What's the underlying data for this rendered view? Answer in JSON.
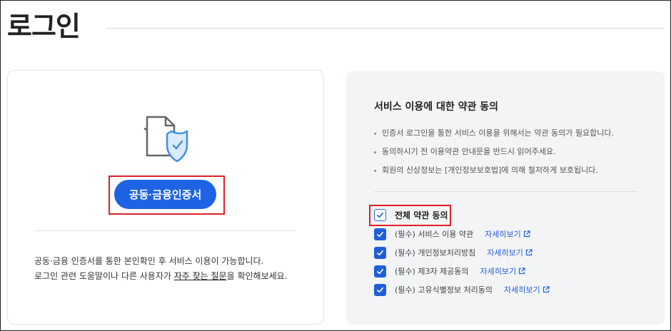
{
  "page": {
    "title": "로그인"
  },
  "login": {
    "button_label": "공동·금융인증서",
    "help_line1": "공동·금융 인증서를 통한 본인확인 후 서비스 이용이 가능합니다.",
    "help_line2_prefix": "로그인 관련 도움말이나 다른 사용자가 ",
    "faq_link": "자주 찾는 질문",
    "help_line2_suffix": "을 확인해보세요."
  },
  "terms": {
    "title": "서비스 이용에 대한 약관 동의",
    "bullets": [
      "인증서 로그인을 통한 서비스 이용을 위해서는 약관 동의가 필요합니다.",
      "동의하시기 전 이용약관 안내문을 반드시 읽어주세요.",
      "회원의 신상정보는 [개인정보보호법]에 의해 철저하게 보호됩니다."
    ],
    "agree_all_label": "전체 약관 동의",
    "items": [
      {
        "label": "(필수) 서비스 이용 약관",
        "link": "자세히보기"
      },
      {
        "label": "(필수) 개인정보처리방침",
        "link": "자세히보기"
      },
      {
        "label": "(필수) 제3자 제공동의",
        "link": "자세히보기"
      },
      {
        "label": "(필수) 고유식별정보 처리동의",
        "link": "자세히보기"
      }
    ]
  },
  "colors": {
    "accent": "#1f63e5",
    "highlight": "#e0202a",
    "panel_bg": "#f3f4f6"
  },
  "icons": {
    "certificate": "certificate-shield-icon",
    "check": "check-icon",
    "external": "external-link-icon"
  }
}
